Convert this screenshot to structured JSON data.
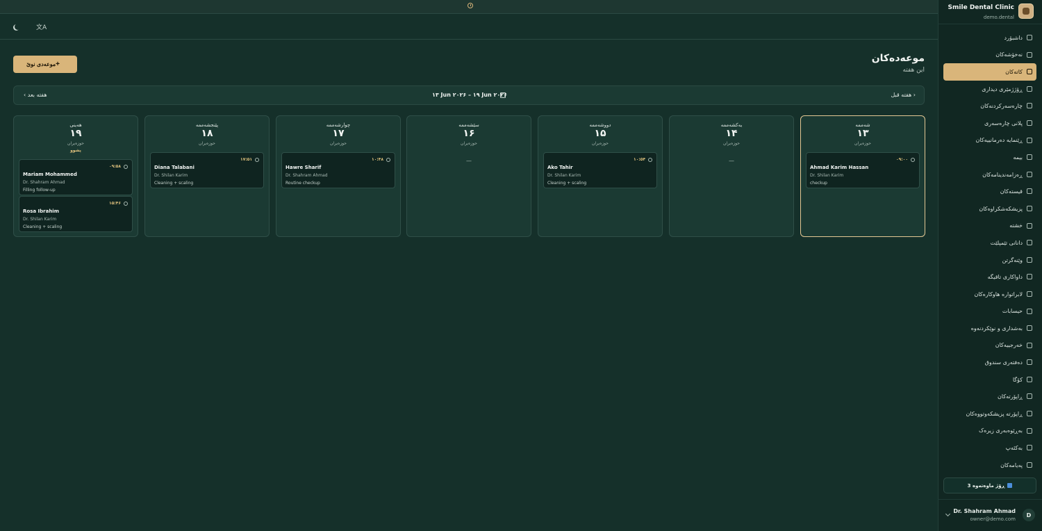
{
  "clinic": {
    "name": "Smile Dental Clinic",
    "domain": "demo.dental"
  },
  "sidebar": {
    "items": [
      {
        "label": "داشبۆرد",
        "icon": "dashboard-icon"
      },
      {
        "label": "نەخۆشەکان",
        "icon": "patients-icon"
      },
      {
        "label": "کاتەکان",
        "icon": "calendar-icon",
        "active": true
      },
      {
        "label": "ڕۆژژمێری دیداری",
        "icon": "calendar-icon"
      },
      {
        "label": "چارەسەرکردنەکان",
        "icon": "clipboard-icon"
      },
      {
        "label": "پلانی چارەسەری",
        "icon": "clipboard-icon"
      },
      {
        "label": "ڕێنمایە دەرمانییەکان",
        "icon": "pill-icon"
      },
      {
        "label": "بیمە",
        "icon": "shield-icon"
      },
      {
        "label": "ڕەزامەندینامەکان",
        "icon": "document-icon"
      },
      {
        "label": "قیستەکان",
        "icon": "invoice-icon"
      },
      {
        "label": "پزیشکەشکراوەکان",
        "icon": "users-icon"
      },
      {
        "label": "خشتە",
        "icon": "table-icon"
      },
      {
        "label": "دانانی تێمپلێت",
        "icon": "template-icon"
      },
      {
        "label": "وێنەگرتن",
        "icon": "image-icon"
      },
      {
        "label": "داواکاری تاقیگە",
        "icon": "flask-icon"
      },
      {
        "label": "لابراتوارە هاوکارەکان",
        "icon": "building-icon"
      },
      {
        "label": "حیسابات",
        "icon": "calculator-icon"
      },
      {
        "label": "بەشداری و نوێکردنەوە",
        "icon": "refresh-icon"
      },
      {
        "label": "خەرجییەکان",
        "icon": "wallet-icon"
      },
      {
        "label": "دەفتەری سندوق",
        "icon": "book-icon"
      },
      {
        "label": "کۆگا",
        "icon": "box-icon"
      },
      {
        "label": "ڕاپۆرتەکان",
        "icon": "chart-icon"
      },
      {
        "label": "ڕاپۆرتە پزیشکەوتووەکان",
        "icon": "trend-icon"
      },
      {
        "label": "بەڕێوەبەری زیرەک",
        "icon": "brain-icon"
      },
      {
        "label": "بەکئەپ",
        "icon": "database-icon"
      },
      {
        "label": "پەیامەکان",
        "icon": "message-icon"
      }
    ],
    "trial_text": "3 ڕۆژ ماوەتەوە",
    "user": {
      "initial": "D",
      "name": "Dr. Shahram Ahmad",
      "email": "owner@demo.com"
    }
  },
  "page": {
    "title": "موعەدەکان",
    "subtitle": "این هفته",
    "new_button": "موعەدی نوێ"
  },
  "week_nav": {
    "prev": "هفته قبل",
    "next": "هفته بعد",
    "range": "۱۳ Jun ۲۰۲۶ – ۱۹ Jun ۲۰۲۶"
  },
  "days": [
    {
      "name": "شەممە",
      "num": "۱۳",
      "month": "حوزەیران",
      "today": true,
      "appointments": [
        {
          "time": "۰۹:۰۰",
          "patient": "Ahmad Karim Hassan",
          "doctor": "Dr. Shilan Karim",
          "service": "checkup"
        }
      ]
    },
    {
      "name": "یەکشەممە",
      "num": "۱۴",
      "month": "حوزەیران",
      "empty": "—",
      "appointments": []
    },
    {
      "name": "دووشەممە",
      "num": "۱۵",
      "month": "حوزەیران",
      "appointments": [
        {
          "time": "۱۰:۵۴",
          "patient": "Ako Tahir",
          "doctor": "Dr. Shilan Karim",
          "service": "Cleaning + scaling"
        }
      ]
    },
    {
      "name": "سێشەممە",
      "num": "۱۶",
      "month": "حوزەیران",
      "empty": "—",
      "appointments": []
    },
    {
      "name": "چوارشەممە",
      "num": "۱۷",
      "month": "حوزەیران",
      "appointments": [
        {
          "time": "۱۰:۴۸",
          "patient": "Hawre Sharif",
          "doctor": "Dr. Shahram Ahmad",
          "service": "Routine checkup"
        }
      ]
    },
    {
      "name": "پێنجشەممە",
      "num": "۱۸",
      "month": "حوزەیران",
      "appointments": [
        {
          "time": "۱۷:۵۱",
          "patient": "Diana Talabani",
          "doctor": "Dr. Shilan Karim",
          "service": "Cleaning + scaling"
        }
      ]
    },
    {
      "name": "هەینی",
      "num": "۱۹",
      "month": "حوزەیران",
      "tag": "پشوو",
      "appointments": [
        {
          "time": "۰۹:۵۸",
          "patient": "Mariam Mohammed",
          "doctor": "Dr. Shahram Ahmad",
          "service": "Filling follow-up"
        },
        {
          "time": "۱۵:۴۶",
          "patient": "Rosa Ibrahim",
          "doctor": "Dr. Shilan Karim",
          "service": "Cleaning + scaling"
        }
      ]
    }
  ]
}
